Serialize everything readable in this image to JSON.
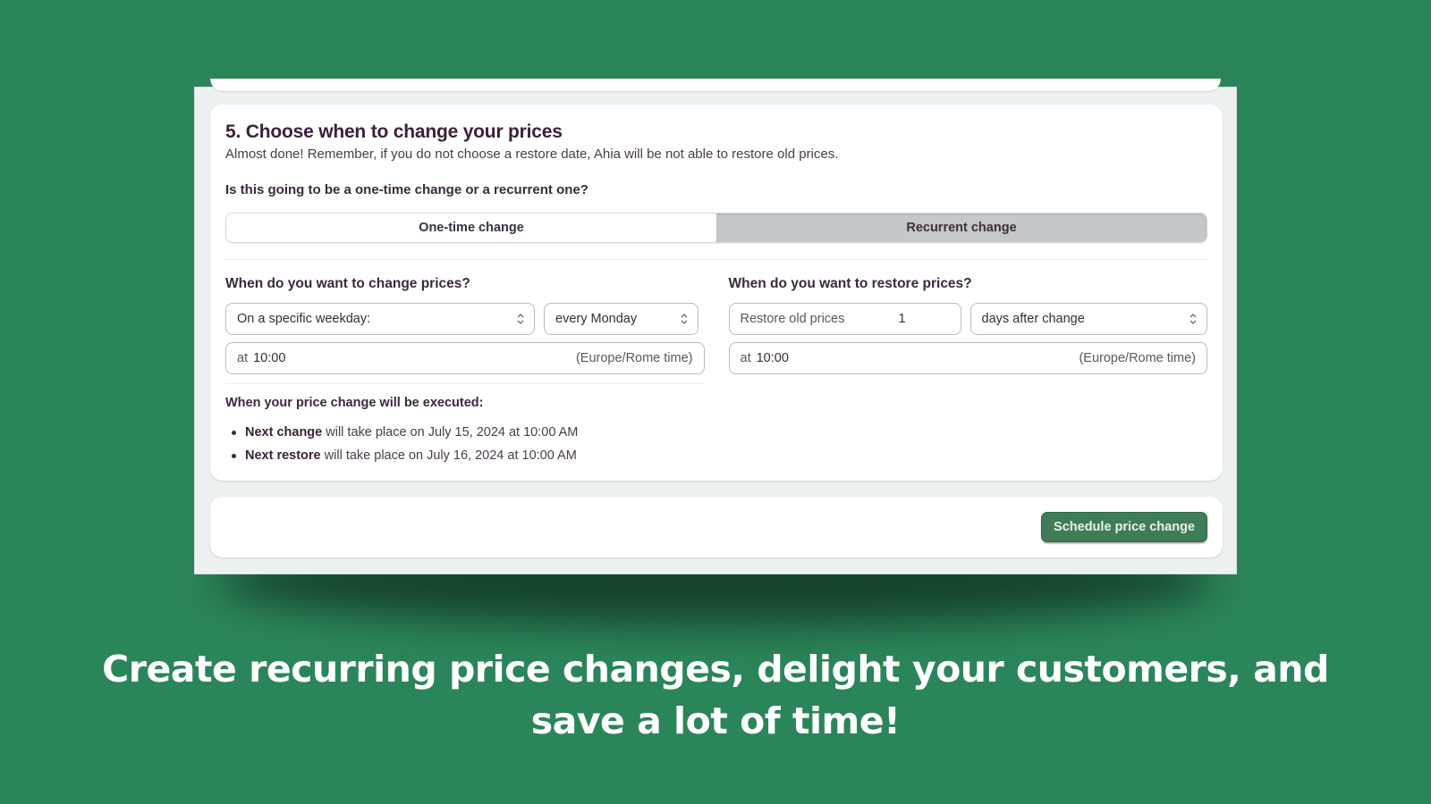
{
  "step": {
    "title": "5. Choose when to change your prices",
    "subtitle": "Almost done! Remember, if you do not choose a restore date, Ahia will be not able to restore old prices.",
    "question": "Is this going to be a one-time change or a recurrent one?",
    "change_type": {
      "options": [
        "One-time change",
        "Recurrent change"
      ],
      "selected": "Recurrent change"
    }
  },
  "change": {
    "label": "When do you want to change prices?",
    "mode_select": "On a specific weekday:",
    "weekday_select": "every Monday",
    "time_prefix": "at",
    "time_value": "10:00",
    "timezone": "(Europe/Rome time)"
  },
  "restore": {
    "label": "When do you want to restore prices?",
    "restore_label": "Restore old prices",
    "restore_value": "1",
    "unit_select": "days after change",
    "time_prefix": "at",
    "time_value": "10:00",
    "timezone": "(Europe/Rome time)"
  },
  "execution": {
    "title": "When your price change will be executed:",
    "items": [
      {
        "bold": "Next change",
        "text": " will take place on July 15, 2024 at 10:00 AM"
      },
      {
        "bold": "Next restore",
        "text": " will take place on July 16, 2024 at 10:00 AM"
      }
    ]
  },
  "footer": {
    "schedule_label": "Schedule price change"
  },
  "caption": {
    "line1": "Create recurring price changes, delight your customers, and",
    "line2": "save a lot of time!"
  },
  "colors": {
    "background": "#2b855a",
    "primary_button": "#3f7c58",
    "segment_active": "#c5c8cb"
  }
}
